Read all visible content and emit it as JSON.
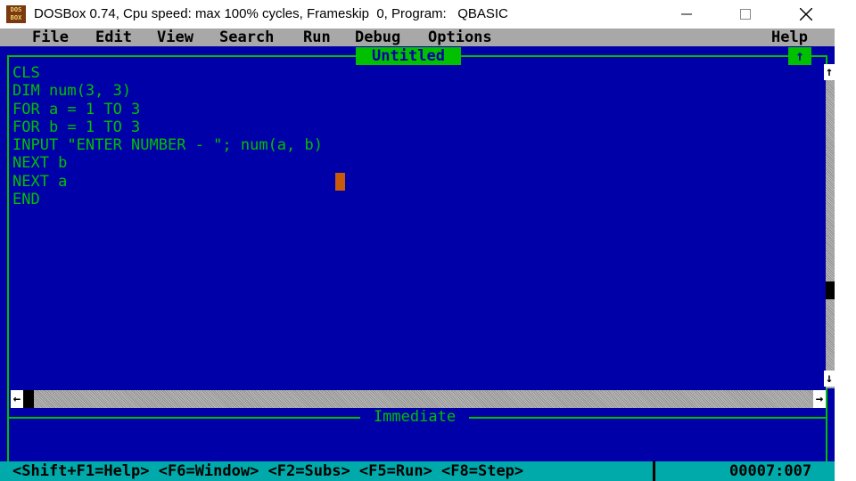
{
  "window": {
    "title": "DOSBox 0.74, Cpu speed: max 100% cycles, Frameskip  0, Program:   QBASIC",
    "icon_text": "DOS BOX",
    "controls": [
      "minimize-icon",
      "maximize-icon",
      "close-icon"
    ]
  },
  "menubar": {
    "items": [
      "File",
      "Edit",
      "View",
      "Search",
      "Run",
      "Debug",
      "Options"
    ],
    "help": "Help"
  },
  "editor": {
    "title": "Untitled",
    "max_button": "↑",
    "lines": [
      "CLS",
      "DIM num(3, 3)",
      "FOR a = 1 TO 3",
      "FOR b = 1 TO 3",
      "INPUT \"ENTER NUMBER - \"; num(a, b)",
      "NEXT b",
      "NEXT a",
      "END"
    ],
    "scroll_up": "↑",
    "scroll_down": "↓",
    "scroll_left": "←",
    "scroll_right": "→"
  },
  "immediate": {
    "title": "Immediate"
  },
  "statusbar": {
    "help_text": "<Shift+F1=Help> <F6=Window> <F2=Subs> <F5=Run> <F8=Step>",
    "position": "00007:007"
  },
  "colors": {
    "screen_bg": "#0000a8",
    "text": "#00c000",
    "menubar": "#a8a8a8",
    "statusbar": "#00aaaa",
    "cursor": "#c85a0a"
  }
}
